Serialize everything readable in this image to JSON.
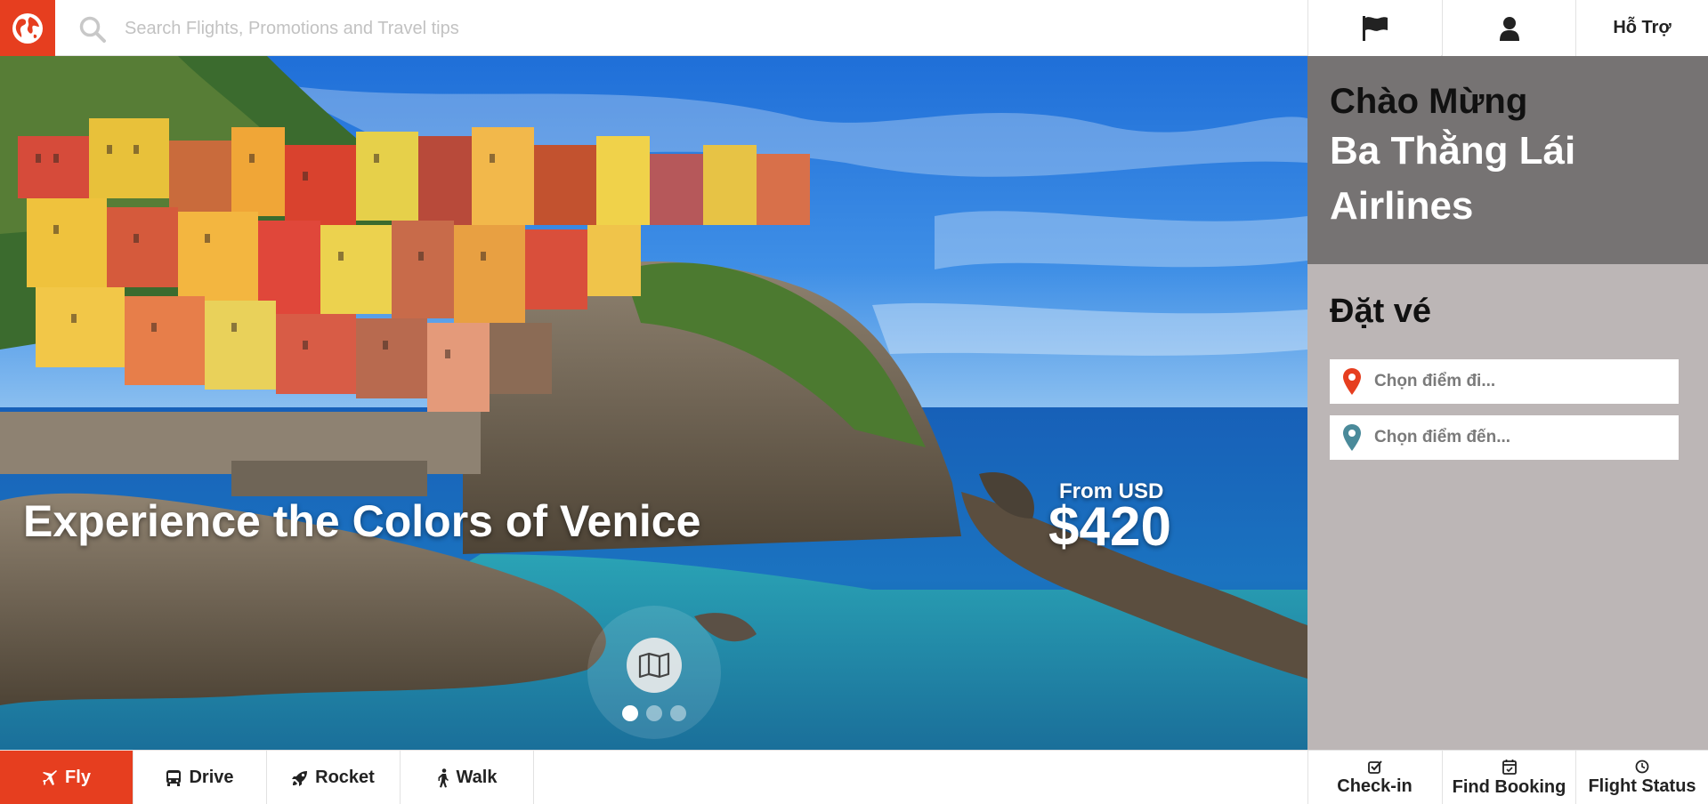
{
  "header": {
    "logo": "globe-logo",
    "search_placeholder": "Search Flights, Promotions and Travel tips",
    "help_label": "Hỗ Trợ"
  },
  "hero": {
    "headline": "Experience the Colors of Venice",
    "price_label": "From USD",
    "price_value": "$420",
    "carousel_dots": 3,
    "active_dot": 1
  },
  "welcome": {
    "line1": "Chào Mừng",
    "line2": "Ba Thằng Lái",
    "line3": "Airlines"
  },
  "booking": {
    "title": "Đặt vé",
    "from_placeholder": "Chọn điểm đi...",
    "to_placeholder": "Chọn điểm đến..."
  },
  "bottom_tabs": [
    {
      "label": "Fly",
      "icon": "plane-icon",
      "active": true
    },
    {
      "label": "Drive",
      "icon": "bus-icon",
      "active": false
    },
    {
      "label": "Rocket",
      "icon": "rocket-icon",
      "active": false
    },
    {
      "label": "Walk",
      "icon": "walk-icon",
      "active": false
    }
  ],
  "bottom_actions": [
    {
      "label": "Check-in",
      "icon": "checkbox-icon"
    },
    {
      "label": "Find Booking",
      "icon": "calendar-check-icon"
    },
    {
      "label": "Flight Status",
      "icon": "clock-icon"
    }
  ],
  "colors": {
    "accent": "#e63e1f",
    "welcome_bg": "#767373",
    "booking_bg": "#bcb6b6",
    "pin_from": "#e63e1f",
    "pin_to": "#4a8a9a"
  }
}
